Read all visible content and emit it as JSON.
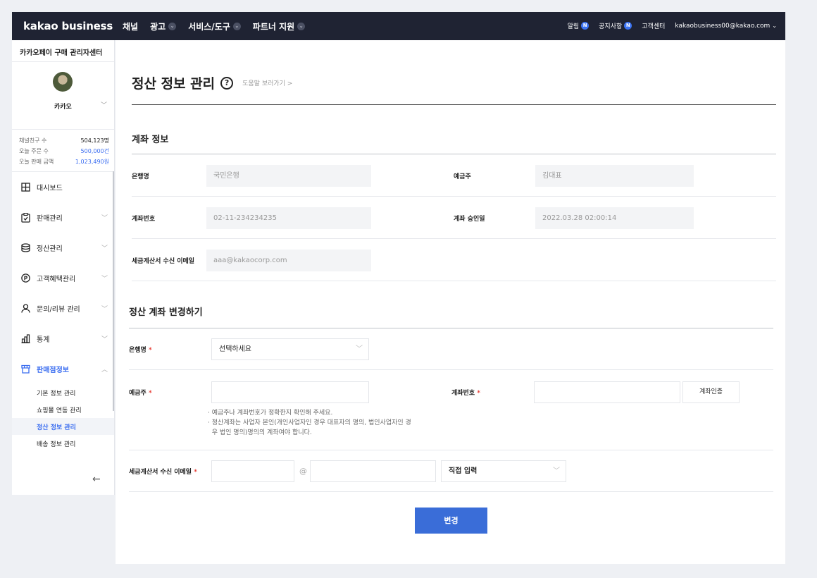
{
  "topbar": {
    "logo": "kakao business",
    "nav": [
      {
        "label": "채널",
        "has_chevron": false
      },
      {
        "label": "광고",
        "has_chevron": true
      },
      {
        "label": "서비스/도구",
        "has_chevron": true
      },
      {
        "label": "파트너 지원",
        "has_chevron": true
      }
    ],
    "right": {
      "alerts": "알림",
      "notices": "공지사항",
      "new_badge": "N",
      "support": "고객센터",
      "account": "kakaobusiness00@kakao.com"
    },
    "colors": {
      "bar": "#1f2333",
      "badge": "#3c74f3"
    }
  },
  "sidebar": {
    "title": "카카오페이 구매 관리자센터",
    "profile_name": "카카오",
    "stats": [
      {
        "label": "채널친구 수",
        "value": "504,123명",
        "highlight": false
      },
      {
        "label": "오늘 주문 수",
        "value": "500,000건",
        "highlight": true
      },
      {
        "label": "오늘 판매 금액",
        "value": "1,023,490원",
        "highlight": true
      }
    ],
    "menu": [
      {
        "label": "대시보드",
        "icon": "dashboard-icon",
        "chevron": ""
      },
      {
        "label": "판매관리",
        "icon": "clipboard-check-icon",
        "chevron": "﹀"
      },
      {
        "label": "정산관리",
        "icon": "database-icon",
        "chevron": "﹀"
      },
      {
        "label": "고객혜택관리",
        "icon": "point-icon",
        "chevron": "﹀"
      },
      {
        "label": "문의/리뷰 관리",
        "icon": "person-icon",
        "chevron": "﹀"
      },
      {
        "label": "통계",
        "icon": "bar-chart-icon",
        "chevron": "﹀"
      },
      {
        "label": "판매점정보",
        "icon": "store-icon",
        "chevron": "︿"
      }
    ],
    "submenu": [
      "기본 정보 관리",
      "쇼핑몰 연동 관리",
      "정산 정보 관리",
      "배송 정보 관리"
    ],
    "active_submenu": "정산 정보 관리",
    "accent": "#3a6df0"
  },
  "page": {
    "title": "정산 정보 관리",
    "help_icon": "?",
    "help_link": "도움말 보러가기 >"
  },
  "account_info": {
    "section_title": "계좌 정보",
    "bank_label": "은행명",
    "bank_value": "국민은행",
    "holder_label": "예금주",
    "holder_value": "김대표",
    "account_label": "계좌번호",
    "account_value": "02-11-234234235",
    "approved_label": "계좌 승인일",
    "approved_value": "2022.03.28 02:00:14",
    "email_label": "세금계산서 수신 이메일",
    "email_value": "aaa@kakaocorp.com"
  },
  "change_form": {
    "section_title": "정산 계좌 변경하기",
    "bank_label": "은행명",
    "bank_placeholder": "선택하세요",
    "holder_label": "예금주",
    "account_label": "계좌번호",
    "verify_button": "계좌인증",
    "required_mark": "*",
    "notes": [
      "· 예금주나 계좌번호가 정확한지 확인해 주세요.",
      "· 정산계좌는 사업자 본인(개인사업자인 경우 대표자의 명의, 법인사업자인 경",
      "  우 법인 명의)명의의 계좌여야 합니다."
    ],
    "email_label": "세금계산서 수신 이메일",
    "email_at": "@",
    "email_domain_select": "직접 입력",
    "submit": "변경"
  }
}
